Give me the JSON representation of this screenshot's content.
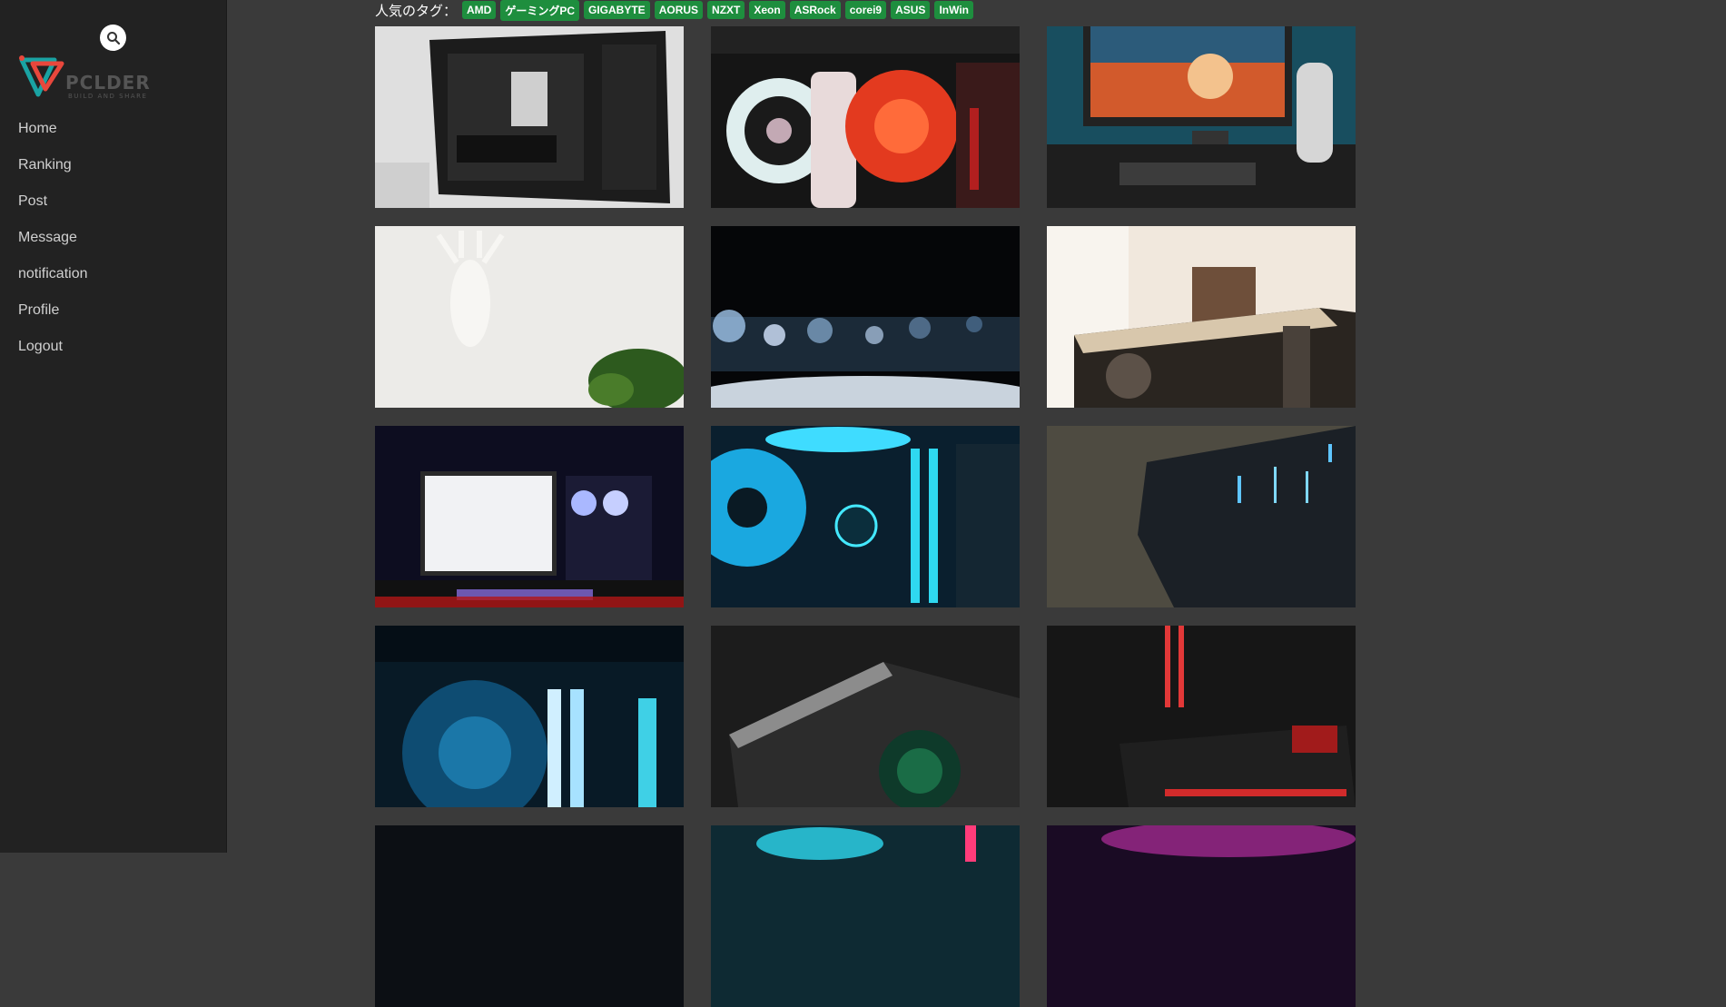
{
  "sidebar": {
    "logo_word": "PCLDER",
    "logo_tagline": "BUILD AND SHARE",
    "search_icon": "search-icon",
    "nav": [
      {
        "label": "Home"
      },
      {
        "label": "Ranking"
      },
      {
        "label": "Post"
      },
      {
        "label": "Message"
      },
      {
        "label": "notification"
      },
      {
        "label": "Profile"
      },
      {
        "label": "Logout"
      }
    ]
  },
  "tags": {
    "label": "人気のタグ：",
    "items": [
      "AMD",
      "ゲーミングPC",
      "GIGABYTE",
      "AORUS",
      "NZXT",
      "Xeon",
      "ASRock",
      "corei9",
      "ASUS",
      "InWin"
    ]
  },
  "colors": {
    "sidebar_bg": "#222222",
    "page_bg": "#3a3a3a",
    "tag_bg": "#1e8e3e",
    "logo_accent_red": "#e8473c",
    "logo_accent_teal": "#1aa3a3"
  },
  "posts": [
    {
      "theme": "black-pc-case-white-wall"
    },
    {
      "theme": "rgb-fans-white-red"
    },
    {
      "theme": "desk-setup-monitor-anime"
    },
    {
      "theme": "white-deer-head-plant"
    },
    {
      "theme": "blue-bokeh-lights"
    },
    {
      "theme": "glass-case-warm-light"
    },
    {
      "theme": "gaming-desk-purple-monitor"
    },
    {
      "theme": "thermaltake-blue-ring"
    },
    {
      "theme": "dark-case-blue-leds"
    },
    {
      "theme": "blue-fan-ram"
    },
    {
      "theme": "dark-case-green-fan"
    },
    {
      "theme": "red-ram-geforce-rtx"
    },
    {
      "theme": "dark-partial"
    },
    {
      "theme": "teal-pink-partial"
    },
    {
      "theme": "magenta-partial"
    }
  ]
}
